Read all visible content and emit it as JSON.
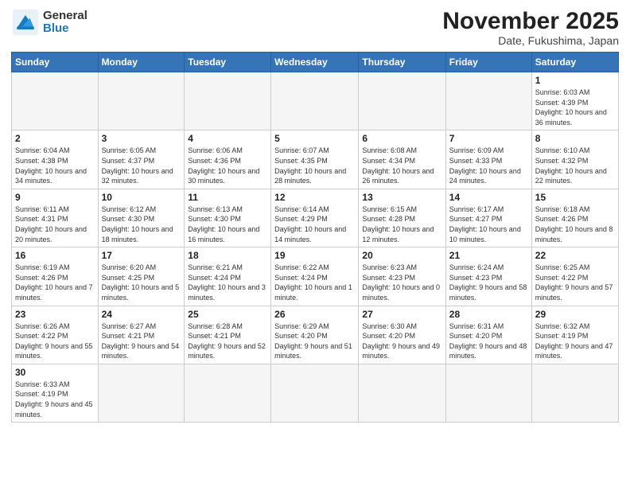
{
  "header": {
    "logo_general": "General",
    "logo_blue": "Blue",
    "month_title": "November 2025",
    "subtitle": "Date, Fukushima, Japan"
  },
  "days_of_week": [
    "Sunday",
    "Monday",
    "Tuesday",
    "Wednesday",
    "Thursday",
    "Friday",
    "Saturday"
  ],
  "weeks": [
    [
      {
        "day": "",
        "info": ""
      },
      {
        "day": "",
        "info": ""
      },
      {
        "day": "",
        "info": ""
      },
      {
        "day": "",
        "info": ""
      },
      {
        "day": "",
        "info": ""
      },
      {
        "day": "",
        "info": ""
      },
      {
        "day": "1",
        "info": "Sunrise: 6:03 AM\nSunset: 4:39 PM\nDaylight: 10 hours\nand 36 minutes."
      }
    ],
    [
      {
        "day": "2",
        "info": "Sunrise: 6:04 AM\nSunset: 4:38 PM\nDaylight: 10 hours\nand 34 minutes."
      },
      {
        "day": "3",
        "info": "Sunrise: 6:05 AM\nSunset: 4:37 PM\nDaylight: 10 hours\nand 32 minutes."
      },
      {
        "day": "4",
        "info": "Sunrise: 6:06 AM\nSunset: 4:36 PM\nDaylight: 10 hours\nand 30 minutes."
      },
      {
        "day": "5",
        "info": "Sunrise: 6:07 AM\nSunset: 4:35 PM\nDaylight: 10 hours\nand 28 minutes."
      },
      {
        "day": "6",
        "info": "Sunrise: 6:08 AM\nSunset: 4:34 PM\nDaylight: 10 hours\nand 26 minutes."
      },
      {
        "day": "7",
        "info": "Sunrise: 6:09 AM\nSunset: 4:33 PM\nDaylight: 10 hours\nand 24 minutes."
      },
      {
        "day": "8",
        "info": "Sunrise: 6:10 AM\nSunset: 4:32 PM\nDaylight: 10 hours\nand 22 minutes."
      }
    ],
    [
      {
        "day": "9",
        "info": "Sunrise: 6:11 AM\nSunset: 4:31 PM\nDaylight: 10 hours\nand 20 minutes."
      },
      {
        "day": "10",
        "info": "Sunrise: 6:12 AM\nSunset: 4:30 PM\nDaylight: 10 hours\nand 18 minutes."
      },
      {
        "day": "11",
        "info": "Sunrise: 6:13 AM\nSunset: 4:30 PM\nDaylight: 10 hours\nand 16 minutes."
      },
      {
        "day": "12",
        "info": "Sunrise: 6:14 AM\nSunset: 4:29 PM\nDaylight: 10 hours\nand 14 minutes."
      },
      {
        "day": "13",
        "info": "Sunrise: 6:15 AM\nSunset: 4:28 PM\nDaylight: 10 hours\nand 12 minutes."
      },
      {
        "day": "14",
        "info": "Sunrise: 6:17 AM\nSunset: 4:27 PM\nDaylight: 10 hours\nand 10 minutes."
      },
      {
        "day": "15",
        "info": "Sunrise: 6:18 AM\nSunset: 4:26 PM\nDaylight: 10 hours\nand 8 minutes."
      }
    ],
    [
      {
        "day": "16",
        "info": "Sunrise: 6:19 AM\nSunset: 4:26 PM\nDaylight: 10 hours\nand 7 minutes."
      },
      {
        "day": "17",
        "info": "Sunrise: 6:20 AM\nSunset: 4:25 PM\nDaylight: 10 hours\nand 5 minutes."
      },
      {
        "day": "18",
        "info": "Sunrise: 6:21 AM\nSunset: 4:24 PM\nDaylight: 10 hours\nand 3 minutes."
      },
      {
        "day": "19",
        "info": "Sunrise: 6:22 AM\nSunset: 4:24 PM\nDaylight: 10 hours\nand 1 minute."
      },
      {
        "day": "20",
        "info": "Sunrise: 6:23 AM\nSunset: 4:23 PM\nDaylight: 10 hours\nand 0 minutes."
      },
      {
        "day": "21",
        "info": "Sunrise: 6:24 AM\nSunset: 4:23 PM\nDaylight: 9 hours\nand 58 minutes."
      },
      {
        "day": "22",
        "info": "Sunrise: 6:25 AM\nSunset: 4:22 PM\nDaylight: 9 hours\nand 57 minutes."
      }
    ],
    [
      {
        "day": "23",
        "info": "Sunrise: 6:26 AM\nSunset: 4:22 PM\nDaylight: 9 hours\nand 55 minutes."
      },
      {
        "day": "24",
        "info": "Sunrise: 6:27 AM\nSunset: 4:21 PM\nDaylight: 9 hours\nand 54 minutes."
      },
      {
        "day": "25",
        "info": "Sunrise: 6:28 AM\nSunset: 4:21 PM\nDaylight: 9 hours\nand 52 minutes."
      },
      {
        "day": "26",
        "info": "Sunrise: 6:29 AM\nSunset: 4:20 PM\nDaylight: 9 hours\nand 51 minutes."
      },
      {
        "day": "27",
        "info": "Sunrise: 6:30 AM\nSunset: 4:20 PM\nDaylight: 9 hours\nand 49 minutes."
      },
      {
        "day": "28",
        "info": "Sunrise: 6:31 AM\nSunset: 4:20 PM\nDaylight: 9 hours\nand 48 minutes."
      },
      {
        "day": "29",
        "info": "Sunrise: 6:32 AM\nSunset: 4:19 PM\nDaylight: 9 hours\nand 47 minutes."
      }
    ],
    [
      {
        "day": "30",
        "info": "Sunrise: 6:33 AM\nSunset: 4:19 PM\nDaylight: 9 hours\nand 45 minutes."
      },
      {
        "day": "",
        "info": ""
      },
      {
        "day": "",
        "info": ""
      },
      {
        "day": "",
        "info": ""
      },
      {
        "day": "",
        "info": ""
      },
      {
        "day": "",
        "info": ""
      },
      {
        "day": "",
        "info": ""
      }
    ]
  ]
}
